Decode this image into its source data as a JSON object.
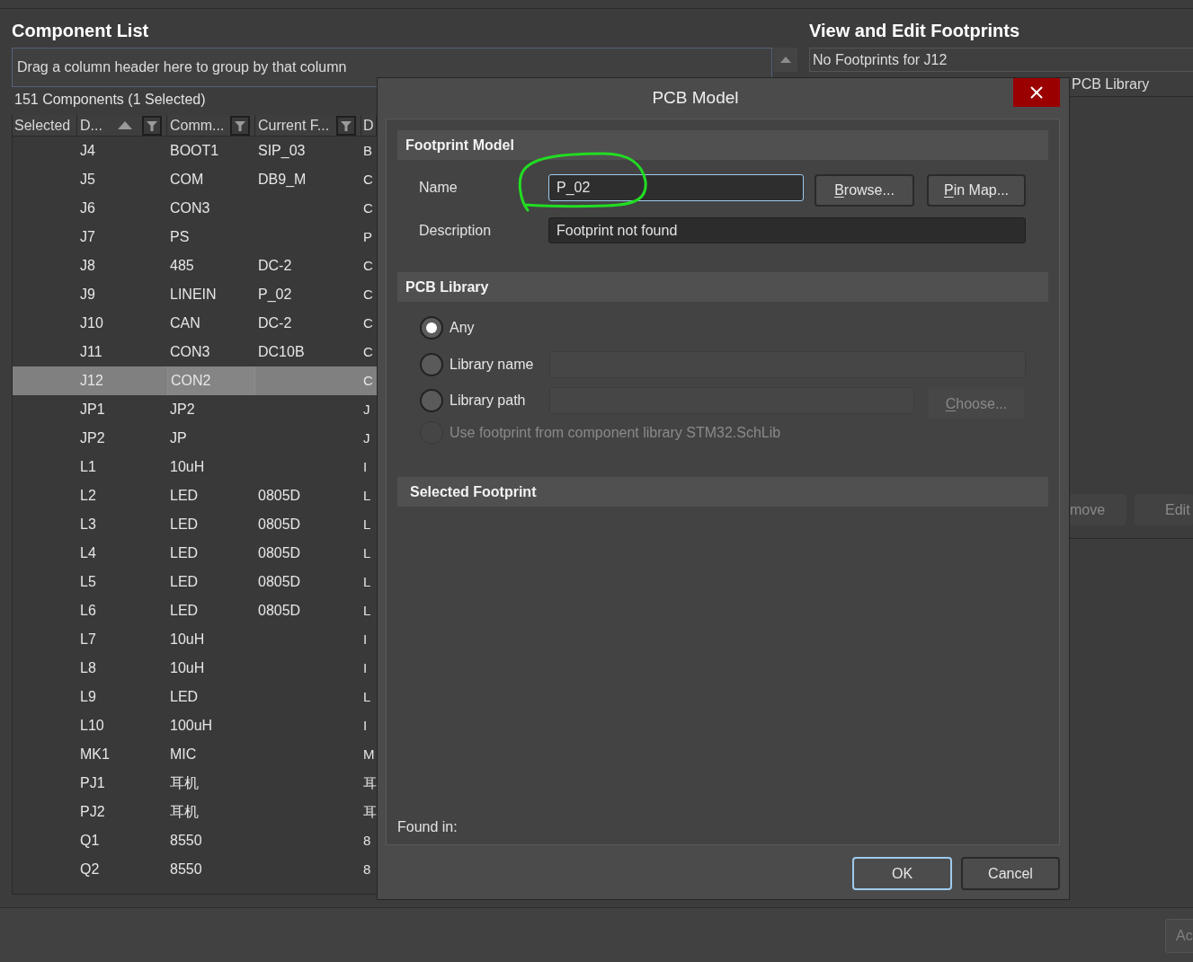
{
  "component_list": {
    "title": "Component List",
    "group_hint": "Drag a column header here to group by that column",
    "count": "151 Components (1 Selected)",
    "columns": [
      {
        "label": "Selected",
        "sorted": false,
        "filter_button": false
      },
      {
        "label": "D...",
        "sorted": true,
        "filter_button": true
      },
      {
        "label": "Comm...",
        "sorted": false,
        "filter_button": true
      },
      {
        "label": "Current F...",
        "sorted": false,
        "filter_button": true
      },
      {
        "label": "D",
        "sorted": false,
        "filter_button": false
      }
    ],
    "rows": [
      {
        "column_2": "J4",
        "column_3": "BOOT1",
        "column_4": "SIP_03",
        "column_5": "B",
        "selected": false
      },
      {
        "column_2": "J5",
        "column_3": "COM",
        "column_4": "DB9_M",
        "column_5": "C",
        "selected": false
      },
      {
        "column_2": "J6",
        "column_3": "CON3",
        "column_5": "C",
        "selected": false
      },
      {
        "column_2": "J7",
        "column_3": "PS",
        "column_5": "P",
        "selected": false
      },
      {
        "column_2": "J8",
        "column_3": "485",
        "column_4": "DC-2",
        "column_5": "C",
        "selected": false
      },
      {
        "column_2": "J9",
        "column_3": "LINEIN",
        "column_4": "P_02",
        "column_5": "C",
        "selected": false
      },
      {
        "column_2": "J10",
        "column_3": "CAN",
        "column_4": "DC-2",
        "column_5": "C",
        "selected": false
      },
      {
        "column_2": "J11",
        "column_3": "CON3",
        "column_4": "DC10B",
        "column_5": "C",
        "selected": false
      },
      {
        "column_2": "J12",
        "column_3": "CON2",
        "column_5": "C",
        "selected": true
      },
      {
        "column_2": "JP1",
        "column_3": "JP2",
        "column_5": "J",
        "selected": false
      },
      {
        "column_2": "JP2",
        "column_3": "JP",
        "column_5": "J",
        "selected": false
      },
      {
        "column_2": "L1",
        "column_3": "10uH",
        "column_5": "I",
        "selected": false
      },
      {
        "column_2": "L2",
        "column_3": "LED",
        "column_4": "0805D",
        "column_5": "L",
        "selected": false
      },
      {
        "column_2": "L3",
        "column_3": "LED",
        "column_4": "0805D",
        "column_5": "L",
        "selected": false
      },
      {
        "column_2": "L4",
        "column_3": "LED",
        "column_4": "0805D",
        "column_5": "L",
        "selected": false
      },
      {
        "column_2": "L5",
        "column_3": "LED",
        "column_4": "0805D",
        "column_5": "L",
        "selected": false
      },
      {
        "column_2": "L6",
        "column_3": "LED",
        "column_4": "0805D",
        "column_5": "L",
        "selected": false
      },
      {
        "column_2": "L7",
        "column_3": "10uH",
        "column_5": "I",
        "selected": false
      },
      {
        "column_2": "L8",
        "column_3": "10uH",
        "column_5": "I",
        "selected": false
      },
      {
        "column_2": "L9",
        "column_3": "LED",
        "column_5": "L",
        "selected": false
      },
      {
        "column_2": "L10",
        "column_3": "100uH",
        "column_5": "I",
        "selected": false
      },
      {
        "column_2": "MK1",
        "column_3": "MIC",
        "column_5": "M",
        "selected": false
      },
      {
        "column_2": "PJ1",
        "column_3": "耳机",
        "column_5": "耳",
        "selected": false
      },
      {
        "column_2": "PJ2",
        "column_3": "耳机",
        "column_5": "耳",
        "selected": false
      },
      {
        "column_2": "Q1",
        "column_3": "8550",
        "column_5": "8",
        "selected": false
      },
      {
        "column_2": "Q2",
        "column_3": "8550",
        "column_5": "8",
        "selected": false
      }
    ]
  },
  "footprints_panel": {
    "title": "View and Edit Footprints",
    "status": "No Footprints for J12",
    "columns": [
      "PCB Library"
    ],
    "buttons": [
      {
        "label": "move",
        "disabled": true
      },
      {
        "label": "Edit",
        "disabled": true
      }
    ]
  },
  "dialog": {
    "title": "PCB Model",
    "footprint_model": {
      "heading": "Footprint Model",
      "name_label": "Name",
      "name_field": {
        "value": "P_02",
        "focused": true,
        "highlighted": true
      },
      "buttons": [
        {
          "label": "Browse...",
          "access_key_shown": true
        },
        {
          "label": "Pin Map...",
          "access_key_shown": true
        }
      ],
      "description_label": "Description",
      "description_field": {
        "value": "Footprint not found"
      }
    },
    "pcb_library": {
      "heading": "PCB Library",
      "options": [
        {
          "kind": "plain",
          "label": "Any",
          "selected": true,
          "disabled": false
        },
        {
          "kind": "field",
          "label": "Library name",
          "selected": false,
          "disabled": false,
          "field": {
            "disabled": true
          }
        },
        {
          "kind": "field_button",
          "label": "Library path",
          "selected": false,
          "disabled": false,
          "field": {
            "disabled": true
          },
          "button": {
            "label": "Choose...",
            "disabled": true,
            "access_key_shown": true
          }
        },
        {
          "kind": "plain",
          "label": "Use footprint from component library STM32.SchLib",
          "selected": false,
          "disabled": true
        }
      ]
    },
    "selected_footprint": {
      "heading": "Selected Footprint",
      "found_in_label": "Found in:"
    },
    "buttons": [
      {
        "label": "OK",
        "default": true
      },
      {
        "label": "Cancel",
        "default": false
      }
    ]
  },
  "bottom_bar": {
    "buttons": [
      {
        "label": "Ac",
        "disabled": true
      }
    ]
  }
}
